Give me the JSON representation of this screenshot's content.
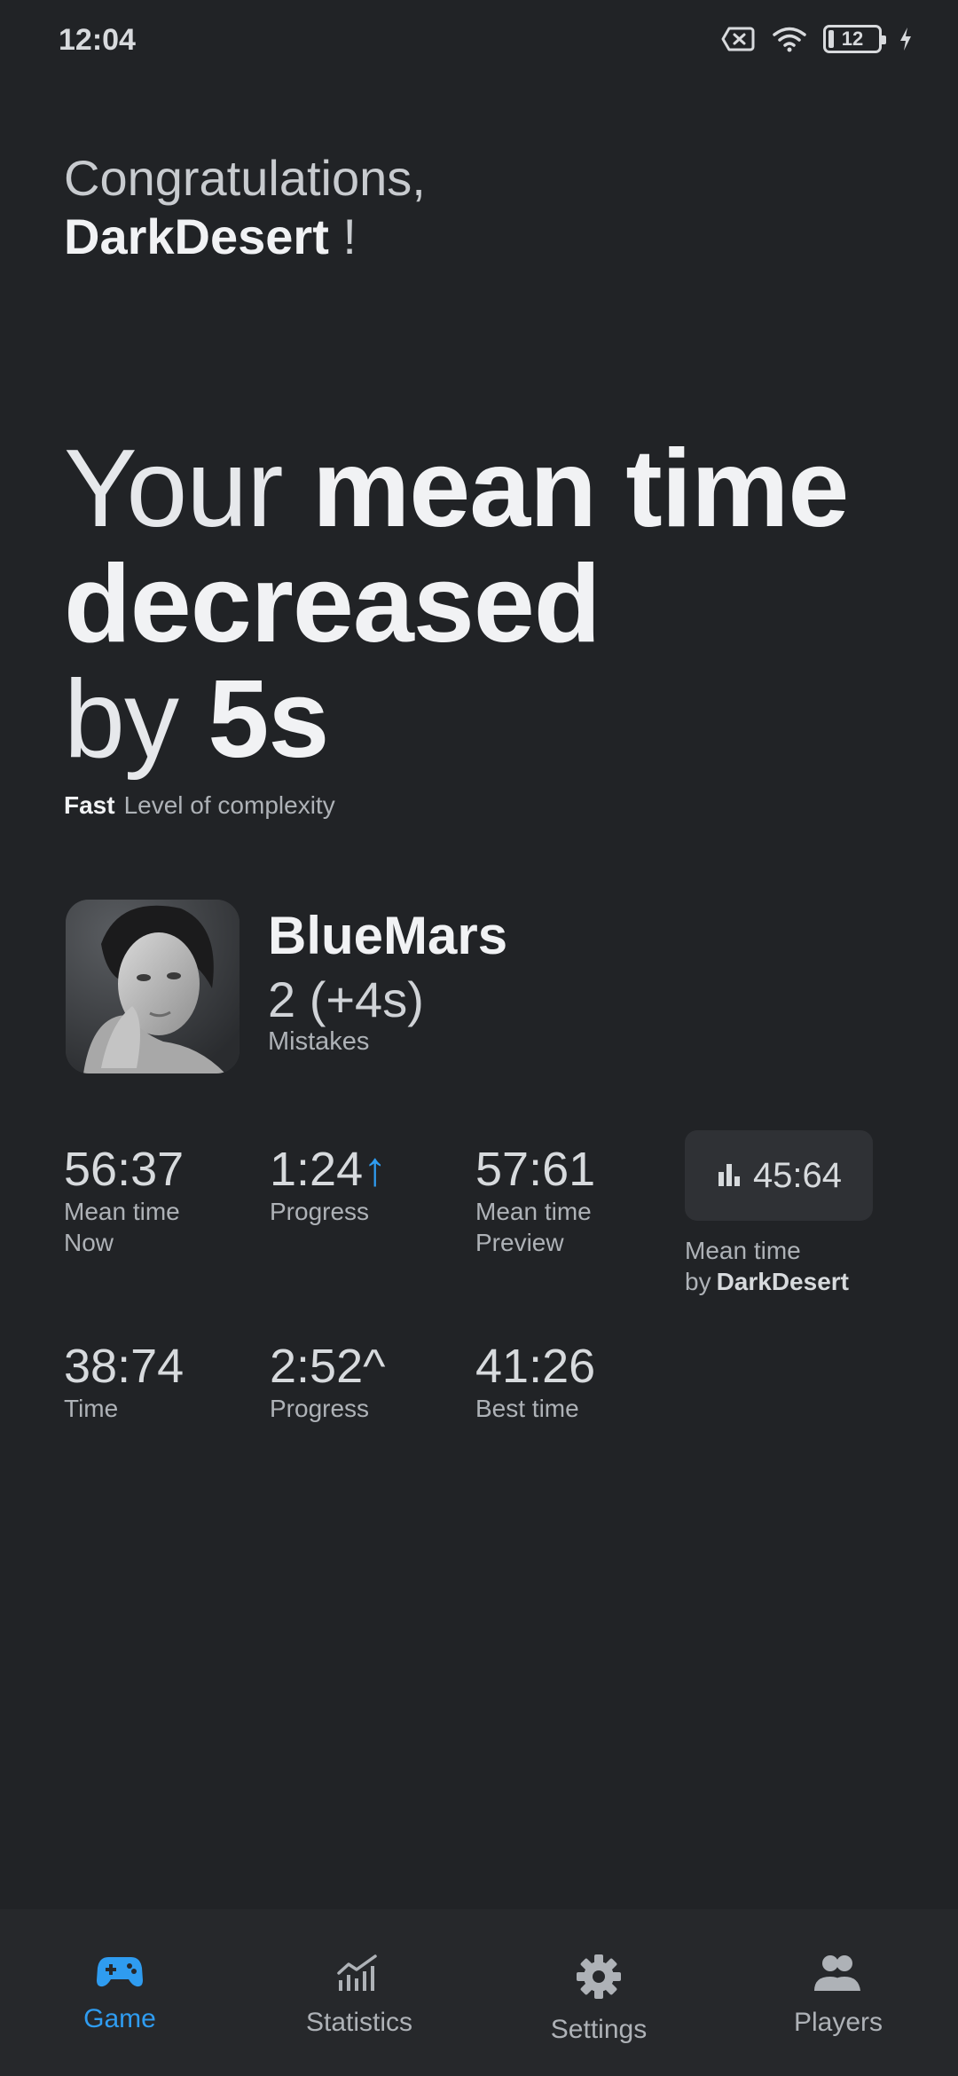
{
  "status_bar": {
    "time": "12:04",
    "battery": "12"
  },
  "greeting": {
    "line1": "Congratulations,",
    "name": "DarkDesert",
    "suffix": " !"
  },
  "headline": {
    "w1": "Your ",
    "w2": "mean time",
    "w3": "decreased",
    "w4": "by ",
    "w5": "5s"
  },
  "complexity": {
    "level": "Fast",
    "label": "Level of complexity"
  },
  "player": {
    "name": "BlueMars",
    "mistakes_value": "2 (+4s)",
    "mistakes_label": "Mistakes"
  },
  "stats": {
    "mean_now": {
      "value": "56:37",
      "label1": "Mean time",
      "label2": "Now"
    },
    "progress1": {
      "value": "1:24",
      "arrow": "↑",
      "label": "Progress"
    },
    "mean_preview": {
      "value": "57:61",
      "label1": "Mean time",
      "label2": "Preview"
    },
    "time": {
      "value": "38:74",
      "label": "Time"
    },
    "progress2": {
      "value": "2:52^",
      "label": "Progress"
    },
    "best_time": {
      "value": "41:26",
      "label": "Best time"
    }
  },
  "mean_card": {
    "value": "45:64",
    "label": "Mean time",
    "by": "by",
    "by_name": "DarkDesert"
  },
  "nav": {
    "game": "Game",
    "statistics": "Statistics",
    "settings": "Settings",
    "players": "Players"
  },
  "colors": {
    "accent": "#2f9cf0",
    "background": "#212326",
    "nav_background": "#26282b"
  }
}
